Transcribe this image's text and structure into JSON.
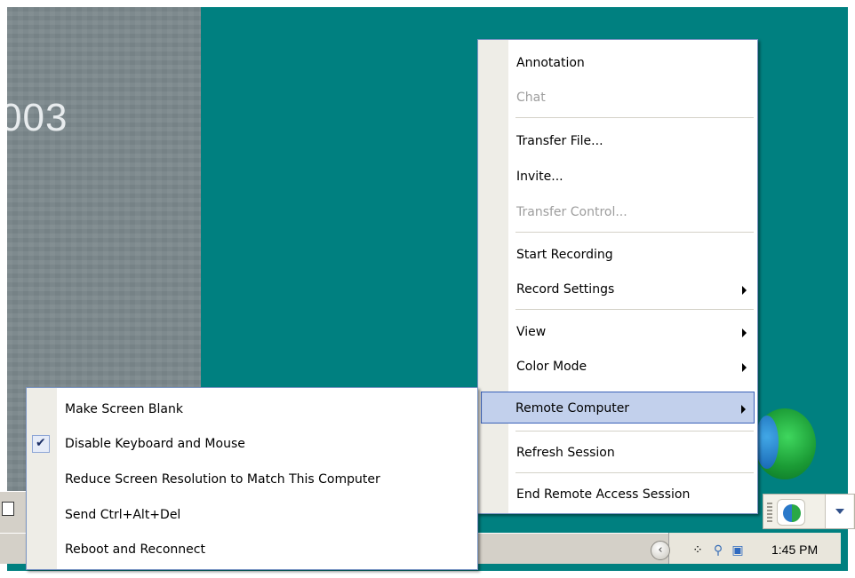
{
  "desktop": {
    "background_text": "003"
  },
  "taskbar": {
    "clock": "1:45 PM",
    "tray_icons": [
      "expand-tray-chevron-icon",
      "network-icon",
      "search-icon",
      "network-computers-icon"
    ]
  },
  "agent_widget": {
    "icons": [
      "grip-handle-icon",
      "remote-assistance-globe-icon",
      "dropdown-arrow-icon"
    ]
  },
  "main_menu": {
    "items": [
      {
        "label": "Annotation",
        "enabled": true
      },
      {
        "label": "Chat",
        "enabled": false
      },
      {
        "label": "Transfer File...",
        "enabled": true
      },
      {
        "label": "Invite...",
        "enabled": true
      },
      {
        "label": "Transfer Control...",
        "enabled": false
      },
      {
        "label": "Start Recording",
        "enabled": true
      },
      {
        "label": "Record Settings",
        "enabled": true,
        "submenu": true
      },
      {
        "label": "View",
        "enabled": true,
        "submenu": true
      },
      {
        "label": "Color Mode",
        "enabled": true,
        "submenu": true
      },
      {
        "label": "Remote Computer",
        "enabled": true,
        "submenu": true,
        "highlighted": true
      },
      {
        "label": "Refresh Session",
        "enabled": true
      },
      {
        "label": "End Remote Access Session",
        "enabled": true
      }
    ]
  },
  "sub_menu": {
    "items": [
      {
        "label": "Make Screen Blank",
        "checked": false
      },
      {
        "label": "Disable Keyboard and Mouse",
        "checked": true
      },
      {
        "label": "Reduce Screen Resolution to Match This Computer",
        "checked": false
      },
      {
        "label": "Send Ctrl+Alt+Del",
        "checked": false
      },
      {
        "label": "Reboot and Reconnect",
        "checked": false
      }
    ]
  },
  "colors": {
    "desktop": "#008080",
    "menu_highlight": "#c2d0ec",
    "menu_border": "#7a95c4",
    "disabled_text": "#9d9d9d"
  }
}
